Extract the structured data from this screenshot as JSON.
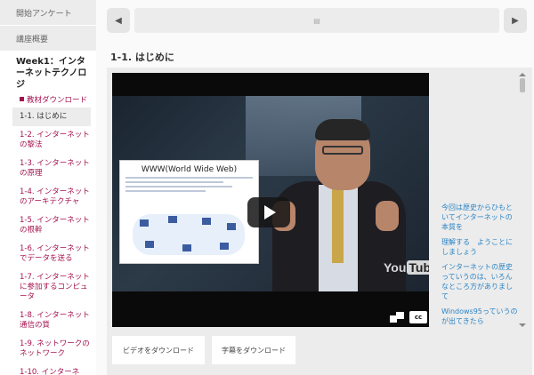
{
  "sidebar": {
    "top_items": [
      "開始アンケート",
      "講座概要"
    ],
    "week_title": "Week1：インターネットテクノロジ",
    "download_label": "教材ダウンロード",
    "items": [
      {
        "label": "1-1. はじめに",
        "active": true
      },
      {
        "label": "1-2. インターネットの黎法",
        "active": false
      },
      {
        "label": "1-3. インターネットの原理",
        "active": false
      },
      {
        "label": "1-4. インターネットのアーキテクチャ",
        "active": false
      },
      {
        "label": "1-5. インターネットの根幹",
        "active": false
      },
      {
        "label": "1-6. インターネットでデータを送る",
        "active": false
      },
      {
        "label": "1-7. インターネットに参加するコンピュータ",
        "active": false
      },
      {
        "label": "1-8. インターネット通信の質",
        "active": false
      },
      {
        "label": "1-9. ネットワークのネットワーク",
        "active": false
      },
      {
        "label": "1-10. インターネ",
        "active": false
      }
    ]
  },
  "slider": {
    "prev_icon": "◀",
    "next_icon": "▶",
    "center_icon": "▤"
  },
  "page": {
    "title": "1-1. はじめに"
  },
  "video": {
    "slide_title": "WWW(World Wide Web)",
    "youtube_you": "You",
    "youtube_tube": "Tube",
    "cc_label": "cc"
  },
  "transcript": {
    "lines": [
      "今回は歴史からひもといてインターネットの本質を",
      "理解する　ようことにしましょう",
      "インターネットの歴史っていうのは、いろんなところ方がありまして",
      "Windows95っていうのが出てきたら"
    ]
  },
  "buttons": {
    "video_download": "ビデオをダウンロード",
    "subtitle_download": "字幕をダウンロード"
  },
  "colors": {
    "link": "#a4134e",
    "transcript": "#2c84c4",
    "panel": "#ececec"
  }
}
